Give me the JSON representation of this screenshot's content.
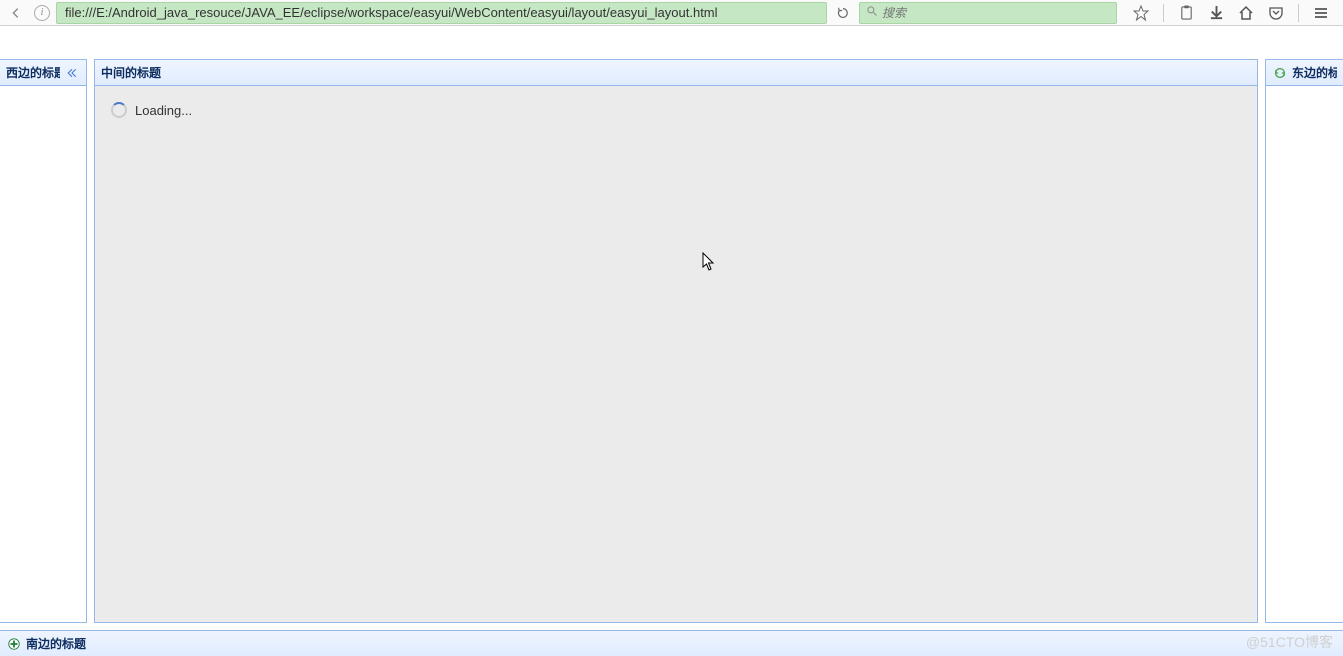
{
  "browser": {
    "url": "file:///E:/Android_java_resouce/JAVA_EE/eclipse/workspace/easyui/WebContent/easyui/layout/easyui_layout.html",
    "search_placeholder": "搜索"
  },
  "layout": {
    "west": {
      "title": "西边的标题"
    },
    "center": {
      "title": "中间的标题",
      "loading_text": "Loading..."
    },
    "east": {
      "title": "东边的标题"
    },
    "south": {
      "title": "南边的标题"
    }
  },
  "watermark": "@51CTO博客"
}
